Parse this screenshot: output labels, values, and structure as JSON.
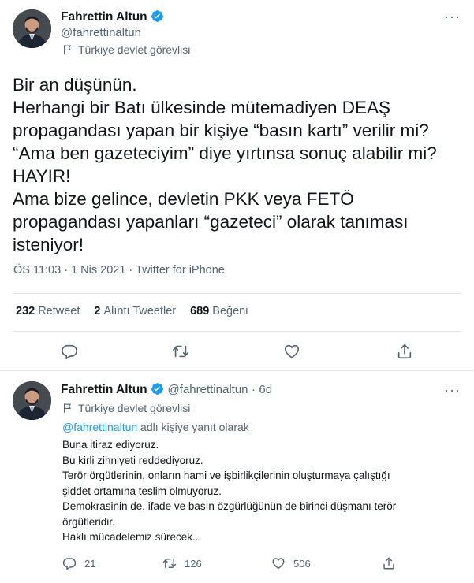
{
  "main_tweet": {
    "author_name": "Fahrettin Altun",
    "author_handle": "@fahrettinaltun",
    "account_label": "Türkiye devlet görevlisi",
    "text_lines": [
      "Bir an düşünün.",
      "Herhangi bir Batı ülkesinde mütemadiyen DEAŞ",
      "propagandası yapan bir kişiye “basın kartı” verilir mi?",
      "“Ama ben gazeteciyim” diye yırtınsa sonuç alabilir mi?",
      "HAYIR!",
      "Ama bize gelince, devletin PKK veya FETÖ",
      "propagandası yapanları “gazeteci” olarak tanıması",
      "isteniyor!"
    ],
    "timestamp": "ÖS 11:03 · 1 Nis 2021 · Twitter for iPhone",
    "stats": {
      "retweets_count": "232",
      "retweets_label": "Retweet",
      "quotes_count": "2",
      "quotes_label": "Alıntı Tweetler",
      "likes_count": "689",
      "likes_label": "Beğeni"
    }
  },
  "reply_tweet": {
    "author_name": "Fahrettin Altun",
    "author_handle": "@fahrettinaltun",
    "separator": "·",
    "age": "6d",
    "account_label": "Türkiye devlet görevlisi",
    "replying_to_handle": "@fahrettinaltun",
    "replying_to_suffix": "adlı kişiye yanıt olarak",
    "text_lines": [
      "Buna itiraz ediyoruz.",
      "Bu kirli zihniyeti reddediyoruz.",
      "Terör örgütlerinin, onların hami ve işbirlikçilerinin oluşturmaya çalıştığı",
      "şiddet ortamına teslim olmuyoruz.",
      "Demokrasinin de, ifade ve basın özgürlüğünün de birinci düşmanı terör",
      "örgütleridir.",
      "Haklı mücadelemiz sürecek..."
    ],
    "reply_count": "21",
    "retweet_count": "126",
    "like_count": "506"
  },
  "colors": {
    "text": "#0f1419",
    "secondary": "#536471",
    "accent": "#1d9bf0",
    "divider": "#e1e6ea"
  },
  "icons": [
    "verified-badge-icon",
    "more-icon",
    "flag-icon",
    "reply-icon",
    "retweet-icon",
    "like-icon",
    "share-icon"
  ]
}
